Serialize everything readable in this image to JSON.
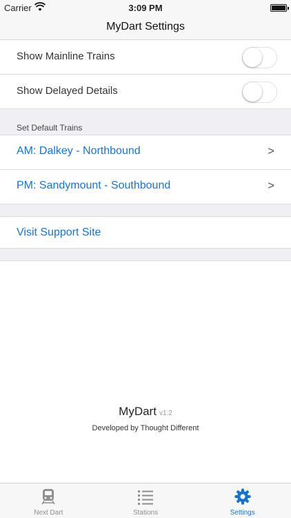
{
  "status_bar": {
    "carrier": "Carrier",
    "time": "3:09 PM"
  },
  "nav": {
    "title": "MyDart Settings"
  },
  "toggles": [
    {
      "label": "Show Mainline Trains",
      "on": false
    },
    {
      "label": "Show Delayed Details",
      "on": false
    }
  ],
  "default_trains": {
    "header": "Set Default Trains",
    "items": [
      {
        "label": "AM: Dalkey - Northbound",
        "chevron": ">"
      },
      {
        "label": "PM: Sandymount - Southbound",
        "chevron": ">"
      }
    ]
  },
  "support": {
    "label": "Visit Support Site"
  },
  "footer": {
    "app_name": "MyDart",
    "version": "v1.2",
    "developer": "Developed by Thought Different"
  },
  "tabs": [
    {
      "label": "Next Dart",
      "icon": "train-icon",
      "active": false
    },
    {
      "label": "Stations",
      "icon": "list-icon",
      "active": false
    },
    {
      "label": "Settings",
      "icon": "gear-icon",
      "active": true
    }
  ],
  "colors": {
    "accent": "#1a73c7",
    "inactive": "#8e8e93",
    "background_gray": "#efeff4"
  }
}
